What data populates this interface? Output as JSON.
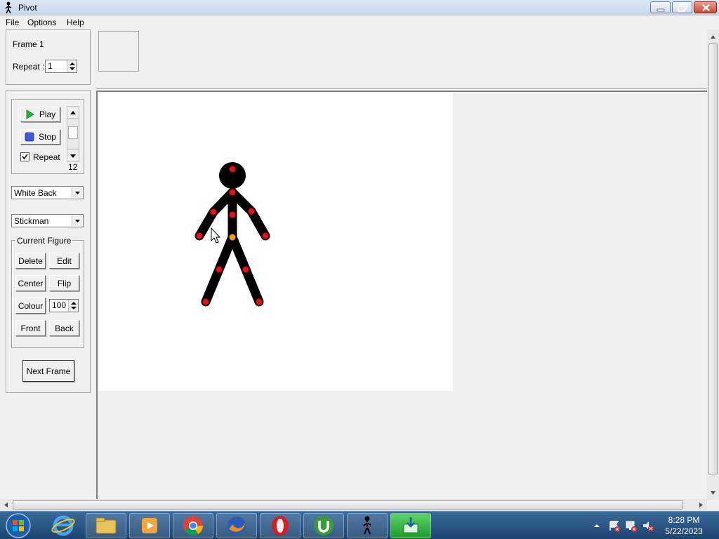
{
  "window": {
    "title": "Pivot"
  },
  "menu": [
    "File",
    "Options",
    "Help"
  ],
  "frame_panel": {
    "frame_label": "Frame 1",
    "repeat_label": "Repeat :",
    "repeat_value": "1"
  },
  "playback": {
    "play_label": "Play",
    "stop_label": "Stop",
    "repeat_label": "Repeat",
    "repeat_checked": true,
    "speed_value": "12"
  },
  "background_select": "White Back",
  "figure_select": "Stickman",
  "current_figure": {
    "group_label": "Current Figure",
    "delete_label": "Delete",
    "edit_label": "Edit",
    "center_label": "Center",
    "flip_label": "Flip",
    "colour_label": "Colour",
    "colour_value": "100",
    "front_label": "Front",
    "back_label": "Back"
  },
  "next_frame_label": "Next Frame",
  "taskbar": {
    "apps": [
      "start-orb",
      "internet-explorer-icon",
      "file-explorer-icon",
      "media-player-icon",
      "chrome-icon",
      "firefox-icon",
      "opera-icon",
      "utorrent-icon",
      "pivot-app-icon",
      "active-app-icon"
    ],
    "time": "8:28 PM",
    "date": "5/22/2023"
  },
  "colors": {
    "figure": "#000000",
    "joint": "#e3121b",
    "pivot_joint": "#f0a020"
  }
}
